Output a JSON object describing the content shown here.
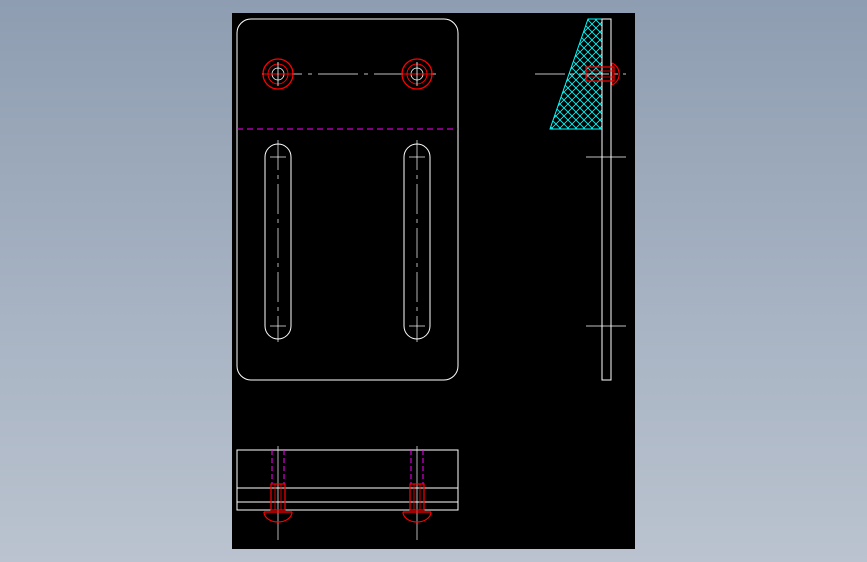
{
  "viewport": {
    "background_color": "#8e9db1",
    "sheet_color": "#000000"
  },
  "drawing": {
    "views": [
      "front-view",
      "side-view",
      "bottom-view"
    ],
    "colors": {
      "outline": "#ffffff",
      "center_line": "#ffffff",
      "bolt": "#ff0000",
      "hidden_line": "#ff00ff",
      "hatch": "#00ffff"
    },
    "front_view": {
      "mounting_holes": 2,
      "slots": 2
    },
    "bottom_view": {
      "bolts": 2
    }
  }
}
